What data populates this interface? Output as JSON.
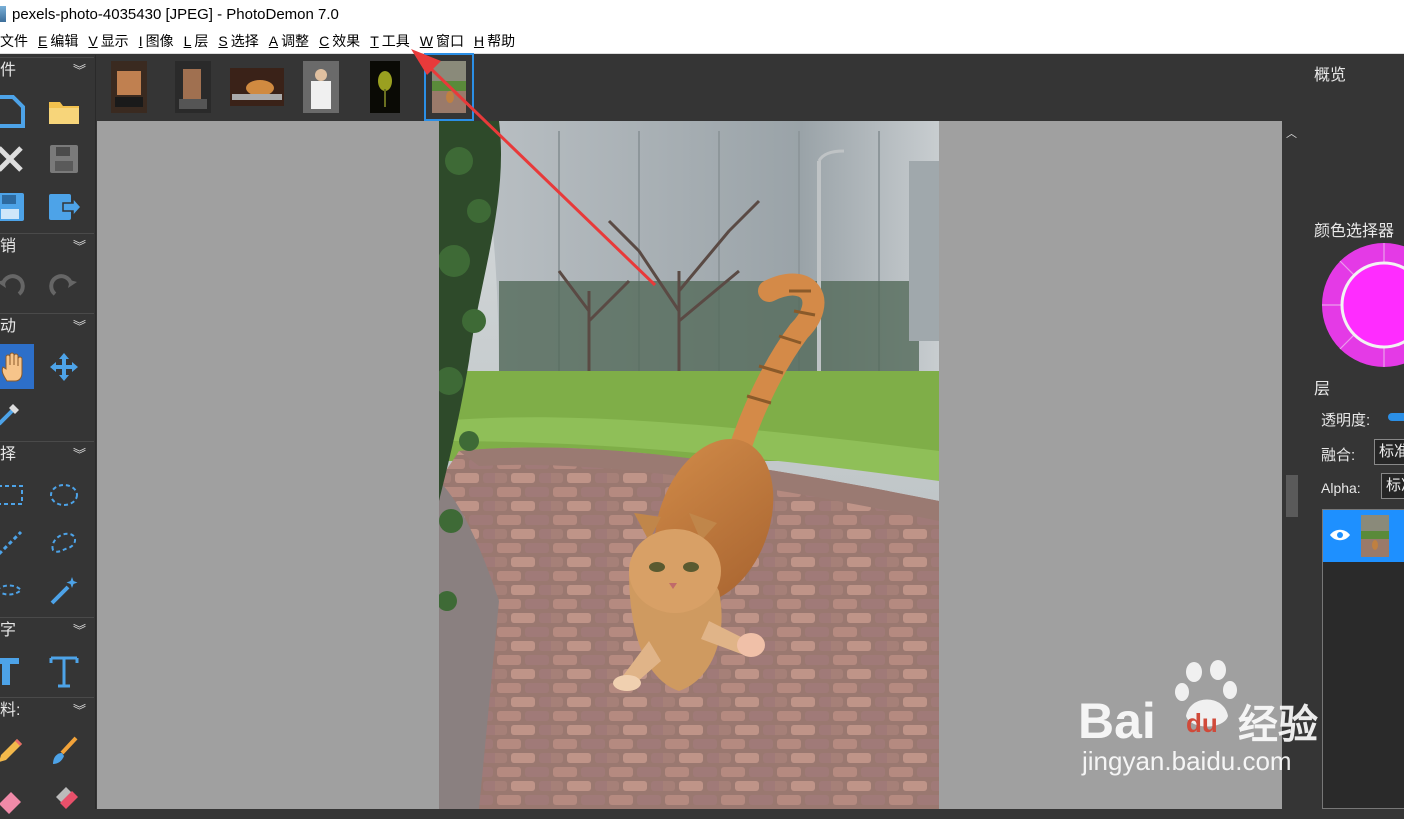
{
  "window": {
    "title": "pexels-photo-4035430 [JPEG]  -  PhotoDemon 7.0"
  },
  "menu": [
    {
      "key": "",
      "label": "文件"
    },
    {
      "key": "E",
      "label": "编辑"
    },
    {
      "key": "V",
      "label": "显示"
    },
    {
      "key": "I",
      "label": "图像"
    },
    {
      "key": "L",
      "label": "层"
    },
    {
      "key": "S",
      "label": "选择"
    },
    {
      "key": "A",
      "label": "调整"
    },
    {
      "key": "C",
      "label": "效果"
    },
    {
      "key": "T",
      "label": "工具"
    },
    {
      "key": "W",
      "label": "窗口"
    },
    {
      "key": "H",
      "label": "帮助"
    }
  ],
  "toolbox": {
    "sections": [
      "件",
      "销",
      "动",
      "择",
      "字",
      "料:"
    ]
  },
  "right_panel": {
    "overview": "概览",
    "color_selector": "颜色选择器",
    "layers": "层",
    "opacity_label": "透明度:",
    "blend_label": "融合:",
    "blend_value": "标准",
    "alpha_label": "Alpha:",
    "alpha_value": "标准"
  },
  "watermark": {
    "line1": "Bai",
    "line2": "du",
    "line3": "经验",
    "url": "jingyan.baidu.com"
  },
  "colors": {
    "accent": "#2b8fe6",
    "layer_selected": "#1e90ff",
    "picker": "#ff2cff"
  },
  "icons": [
    "new-file-icon",
    "open-folder-icon",
    "close-icon",
    "save-icon",
    "save-as-icon",
    "export-icon",
    "undo-icon",
    "redo-icon",
    "hand-icon",
    "move-icon",
    "eyedropper-icon",
    "rect-select-icon",
    "ellipse-select-icon",
    "line-select-icon",
    "lasso-icon",
    "polygon-lasso-icon",
    "magic-wand-icon",
    "text-bold-icon",
    "text-icon",
    "pencil-icon",
    "brush-icon",
    "eraser-icon",
    "fill-icon",
    "eye-icon"
  ]
}
